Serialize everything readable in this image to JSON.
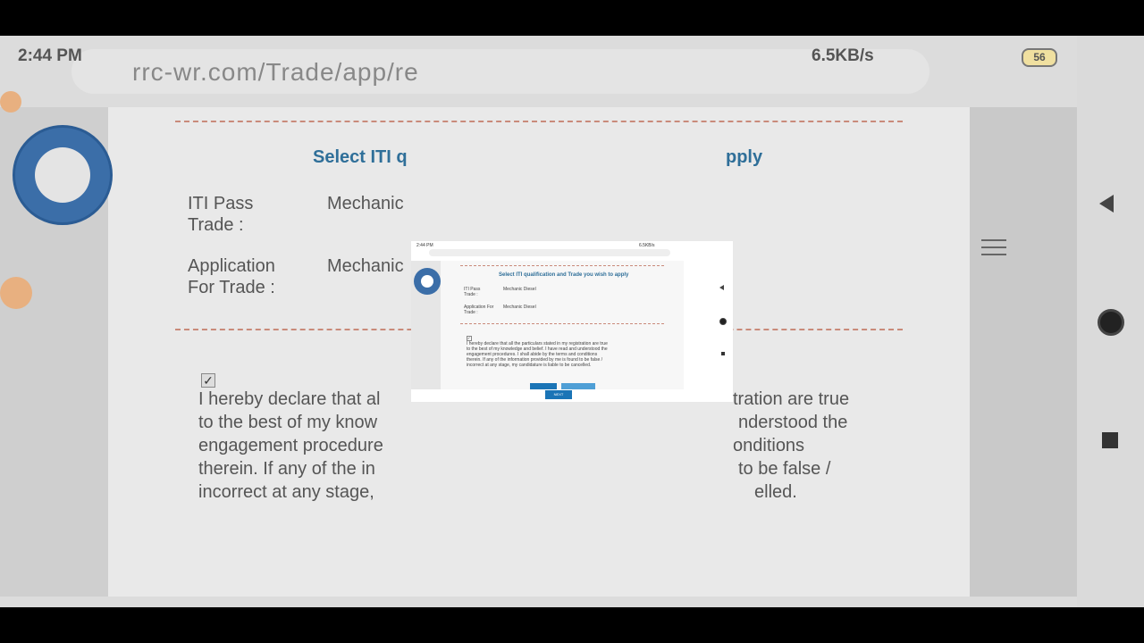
{
  "background": {
    "status_time": "2:44 PM",
    "status_right": "6.5KB/s",
    "battery": "56",
    "url": "rrc-wr.com/Trade/app/re",
    "title_left": "Select ITI q",
    "title_right": "pply",
    "iti_pass_label_1": "ITI Pass",
    "iti_pass_label_2": "Trade :",
    "iti_pass_value": "Mechanic",
    "application_label_1": "Application",
    "application_label_2": "For Trade :",
    "application_value": "Mechanic",
    "checkbox": "✓",
    "decl_left": [
      "I hereby declare that al",
      "to the best of my know",
      "engagement procedure",
      "therein. If any of the in",
      "incorrect at any stage,"
    ],
    "decl_right": [
      "tration are true",
      "nderstood the",
      "onditions",
      "to be false /",
      "elled."
    ]
  },
  "popup": {
    "status_time": "2:44 PM",
    "status_right": "6.5KB/s",
    "title": "Select ITI qualification and Trade you wish to apply",
    "iti_pass_label": "ITI Pass Trade :",
    "iti_pass_value": "Mechanic Diesel",
    "application_label": "Application For Trade :",
    "application_value": "Mechanic Diesel",
    "checkbox": "✓",
    "declaration": [
      "I hereby declare that all the particulars stated in my registration are true",
      "to the best of my knowledge and belief. I have read and understood the",
      "engagement procedures. I shall abide by the terms and conditions",
      "therein. If any of the information provided by me is found to be false /",
      "incorrect at any stage, my candidature is liable to be cancelled."
    ],
    "next_label": "NEXT"
  }
}
